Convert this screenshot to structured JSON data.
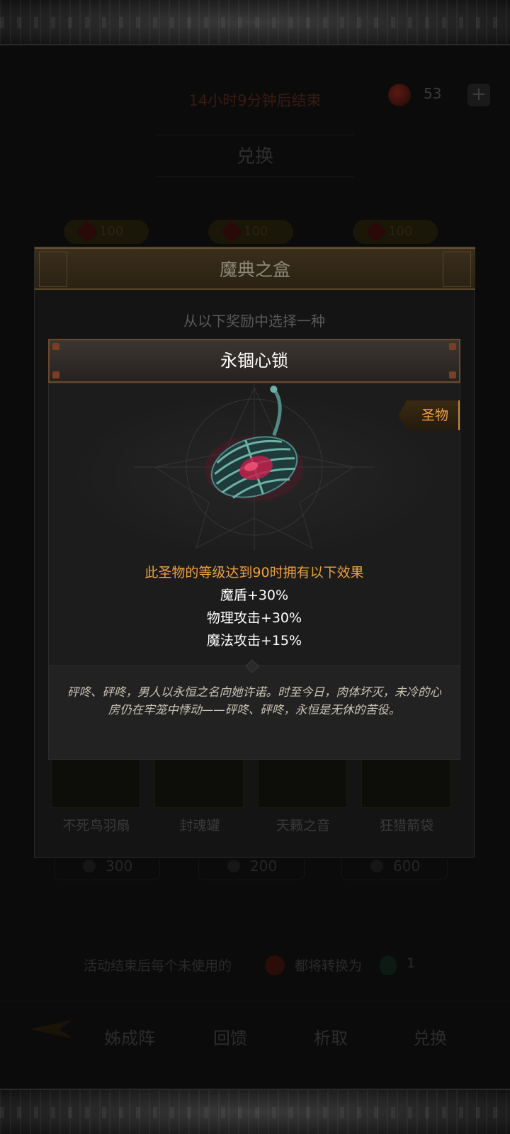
{
  "background": {
    "timer": "14小时9分钟后结束",
    "currency_count": "53",
    "currency_plus": "+",
    "tab_title": "兑换",
    "prices": [
      "100",
      "100",
      "100"
    ],
    "cards": [
      {
        "name": "不死鸟羽扇",
        "cost": "300"
      },
      {
        "name": "封魂罐",
        "cost": "200"
      },
      {
        "name": "天籁之音",
        "cost": "600"
      },
      {
        "name": "狂猎箭袋",
        "cost": ""
      }
    ],
    "notice_part1": "活动结束后每个未使用的",
    "notice_part2": "都将转换为",
    "notice_part3": "1",
    "nav": [
      "姊成阵",
      "回馈",
      "析取",
      "兑换"
    ]
  },
  "outer_modal": {
    "title": "魔典之盒",
    "subtitle": "从以下奖励中选择一种"
  },
  "item": {
    "name": "永锢心锁",
    "category": "圣物",
    "effect_header": "此圣物的等级达到90时拥有以下效果",
    "effects": [
      "魔盾+30%",
      "物理攻击+30%",
      "魔法攻击+15%"
    ],
    "lore": "砰咚、砰咚，男人以永恒之名向她许诺。时至今日，肉体坏灭，未冷的心房仍在牢笼中悸动——砰咚、砰咚，永恒是无休的苦役。"
  },
  "colors": {
    "accent_orange": "#f0a040",
    "header_border": "#6a4a2e",
    "panel_bg": "#1c1c1c"
  }
}
